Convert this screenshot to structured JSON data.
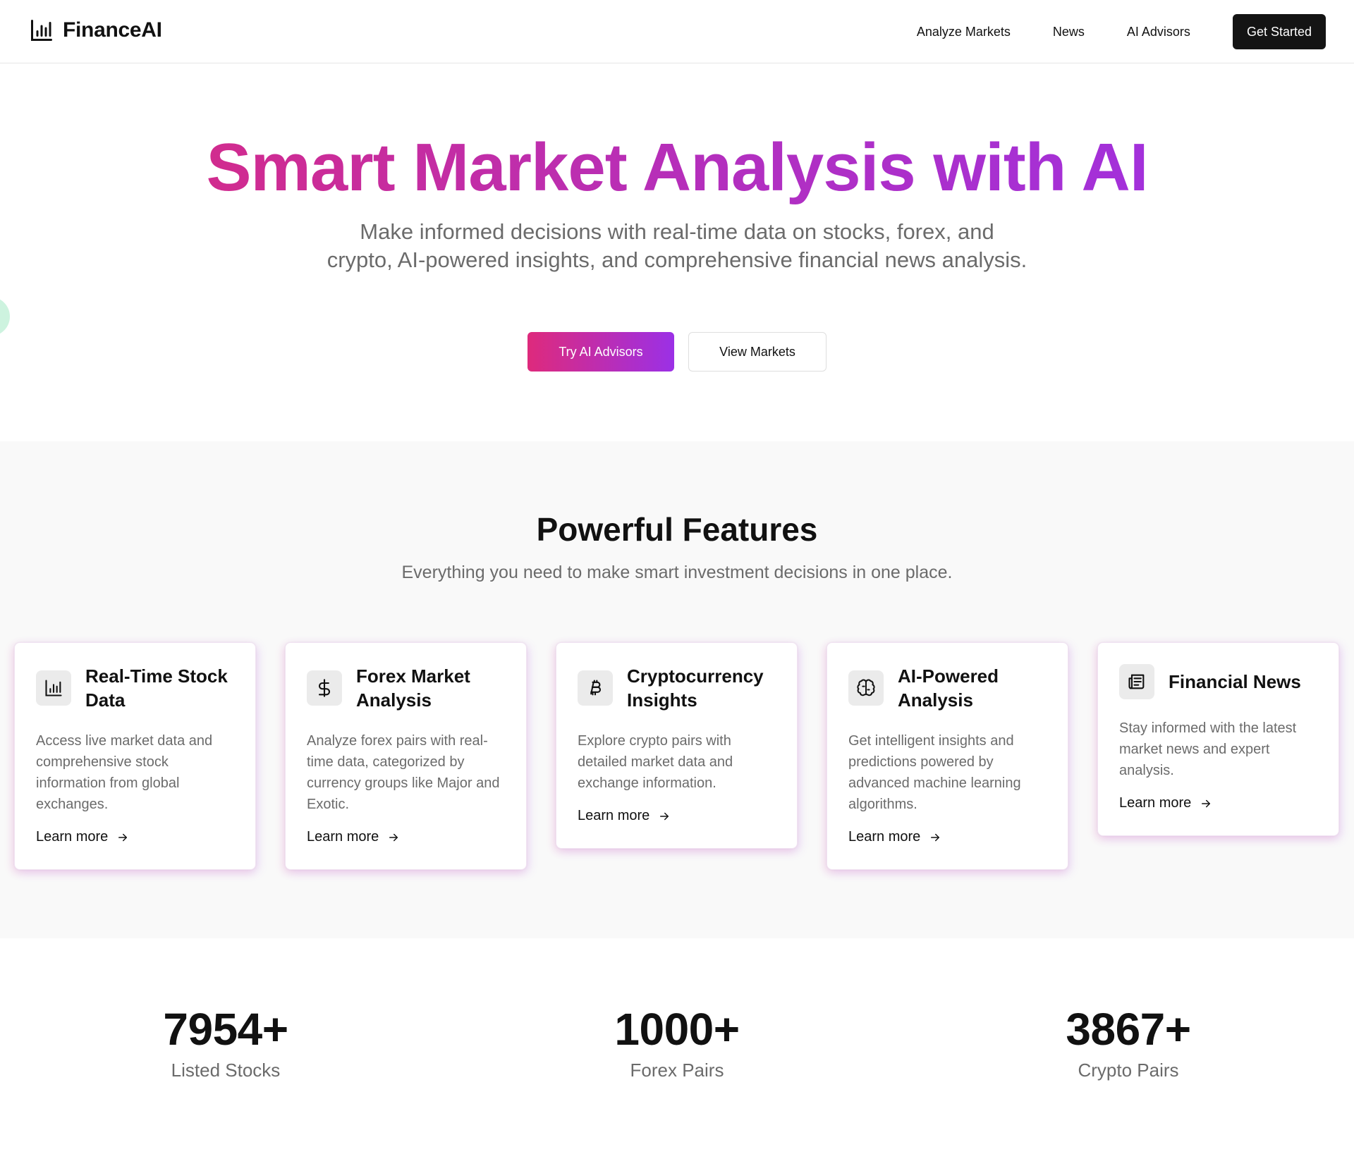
{
  "brand": {
    "name": "FinanceAI",
    "icon": "bar-chart-icon"
  },
  "nav": {
    "links": [
      "Analyze Markets",
      "News",
      "AI Advisors"
    ],
    "cta": "Get Started"
  },
  "hero": {
    "title": "Smart Market Analysis with AI",
    "subtitle": "Make informed decisions with real-time data on stocks, forex, and crypto, AI-powered insights, and comprehensive financial news analysis.",
    "primary_button": "Try AI Advisors",
    "secondary_button": "View Markets",
    "gradient": [
      "#dd2a7b",
      "#9b30e8"
    ]
  },
  "features": {
    "title": "Powerful Features",
    "subtitle": "Everything you need to make smart investment decisions in one place.",
    "cards": [
      {
        "icon": "bar-chart-icon",
        "title": "Real-Time Stock Data",
        "description": "Access live market data and comprehensive stock information from global exchanges.",
        "link": "Learn more"
      },
      {
        "icon": "dollar-icon",
        "title": "Forex Market Analysis",
        "description": "Analyze forex pairs with real-time data, categorized by currency groups like Major and Exotic.",
        "link": "Learn more"
      },
      {
        "icon": "bitcoin-icon",
        "title": "Cryptocurrency Insights",
        "description": "Explore crypto pairs with detailed market data and exchange information.",
        "link": "Learn more"
      },
      {
        "icon": "brain-icon",
        "title": "AI-Powered Analysis",
        "description": "Get intelligent insights and predictions powered by advanced machine learning algorithms.",
        "link": "Learn more"
      },
      {
        "icon": "newspaper-icon",
        "title": "Financial News",
        "description": "Stay informed with the latest market news and expert analysis.",
        "link": "Learn more"
      }
    ]
  },
  "stats": [
    {
      "value": "7954+",
      "label": "Listed Stocks"
    },
    {
      "value": "1000+",
      "label": "Forex Pairs"
    },
    {
      "value": "3867+",
      "label": "Crypto Pairs"
    }
  ]
}
